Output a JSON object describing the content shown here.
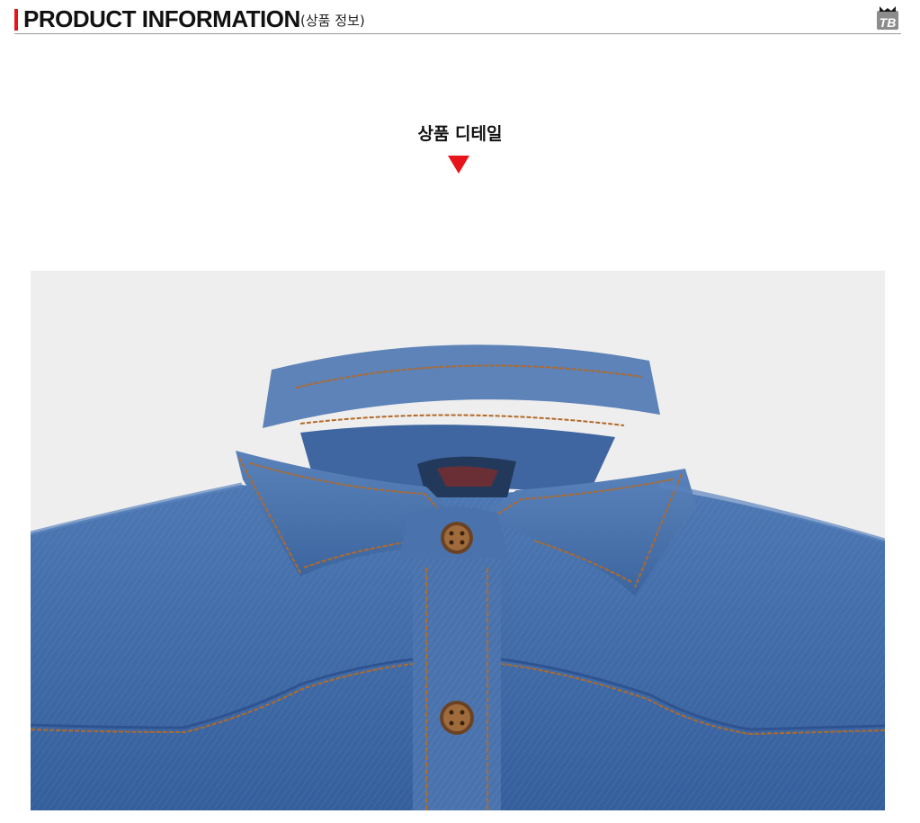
{
  "header": {
    "title": "PRODUCT INFORMATION",
    "subtitle": "(상품 정보)",
    "accent_color": "#e8141c",
    "logo_icon": "tb-brand-logo-icon"
  },
  "section": {
    "heading": "상품 디테일",
    "arrow_icon": "triangle-down-icon",
    "arrow_color": "#e8141c"
  },
  "product_image": {
    "subject": "denim-shirt-collar-detail",
    "background_color": "#efeeee",
    "denim_color": "#3f6aa6",
    "stitch_color": "#b06a2a"
  }
}
